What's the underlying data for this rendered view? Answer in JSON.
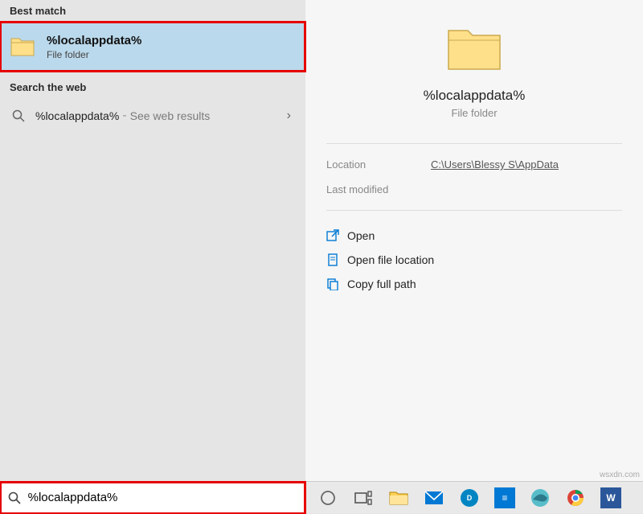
{
  "left": {
    "best_match_header": "Best match",
    "result": {
      "title": "%localappdata%",
      "subtitle": "File folder"
    },
    "web_header": "Search the web",
    "web_result": {
      "term": "%localappdata%",
      "hint": "See web results"
    }
  },
  "preview": {
    "title": "%localappdata%",
    "subtitle": "File folder",
    "location_label": "Location",
    "location_value": "C:\\Users\\Blessy S\\AppData",
    "modified_label": "Last modified",
    "modified_value": ""
  },
  "actions": {
    "open": "Open",
    "open_location": "Open file location",
    "copy_path": "Copy full path"
  },
  "search": {
    "value": "%localappdata%"
  },
  "watermark": "wsxdn.com"
}
